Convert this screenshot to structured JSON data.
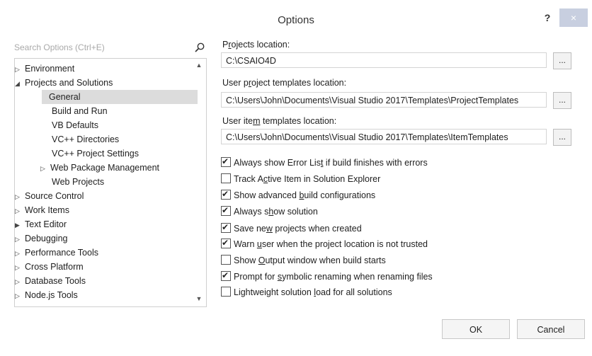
{
  "window": {
    "title": "Options",
    "help_label": "?",
    "close_label": "×"
  },
  "search": {
    "placeholder": "Search Options (Ctrl+E)"
  },
  "tree": {
    "items": [
      {
        "label": "Environment",
        "arrow": "▷"
      },
      {
        "label": "Projects and Solutions",
        "arrow": "◢"
      },
      {
        "label": "General",
        "arrow": ""
      },
      {
        "label": "Build and Run",
        "arrow": ""
      },
      {
        "label": "VB Defaults",
        "arrow": ""
      },
      {
        "label": "VC++ Directories",
        "arrow": ""
      },
      {
        "label": "VC++ Project Settings",
        "arrow": ""
      },
      {
        "label": "Web Package Management",
        "arrow": "▷"
      },
      {
        "label": "Web Projects",
        "arrow": ""
      },
      {
        "label": "Source Control",
        "arrow": "▷"
      },
      {
        "label": "Work Items",
        "arrow": "▷"
      },
      {
        "label": "Text Editor",
        "arrow": "▶"
      },
      {
        "label": "Debugging",
        "arrow": "▷"
      },
      {
        "label": "Performance Tools",
        "arrow": "▷"
      },
      {
        "label": "Cross Platform",
        "arrow": "▷"
      },
      {
        "label": "Database Tools",
        "arrow": "▷"
      },
      {
        "label": "Node.js Tools",
        "arrow": "▷"
      }
    ],
    "scroll_up": "▲",
    "scroll_down": "▼"
  },
  "settings": {
    "projects_location": {
      "label_pre": "P",
      "label_u": "r",
      "label_post": "ojects location:",
      "value": "C:\\CSAIO4D"
    },
    "user_project_templates": {
      "label_pre": "User p",
      "label_u": "r",
      "label_post": "oject templates location:",
      "value": "C:\\Users\\John\\Documents\\Visual Studio 2017\\Templates\\ProjectTemplates"
    },
    "user_item_templates": {
      "label_pre": "User ite",
      "label_u": "m",
      "label_post": " templates location:",
      "value": "C:\\Users\\John\\Documents\\Visual Studio 2017\\Templates\\ItemTemplates"
    },
    "browse_label": "...",
    "checkboxes": [
      {
        "pre": "Always show Error Lis",
        "u": "t",
        "post": " if build finishes with errors",
        "checked": true
      },
      {
        "pre": "Track A",
        "u": "c",
        "post": "tive Item in Solution Explorer",
        "checked": false
      },
      {
        "pre": "Show advanced ",
        "u": "b",
        "post": "uild configurations",
        "checked": true
      },
      {
        "pre": "Always s",
        "u": "h",
        "post": "ow solution",
        "checked": true
      },
      {
        "pre": "Save ne",
        "u": "w",
        "post": " projects when created",
        "checked": true
      },
      {
        "pre": "Warn ",
        "u": "u",
        "post": "ser when the project location is not trusted",
        "checked": true
      },
      {
        "pre": "Show ",
        "u": "O",
        "post": "utput window when build starts",
        "checked": false
      },
      {
        "pre": "Prompt for ",
        "u": "s",
        "post": "ymbolic renaming when renaming files",
        "checked": true
      },
      {
        "pre": "Lightweight solution ",
        "u": "l",
        "post": "oad for all solutions",
        "checked": false
      }
    ]
  },
  "footer": {
    "ok_label": "OK",
    "cancel_label": "Cancel"
  }
}
